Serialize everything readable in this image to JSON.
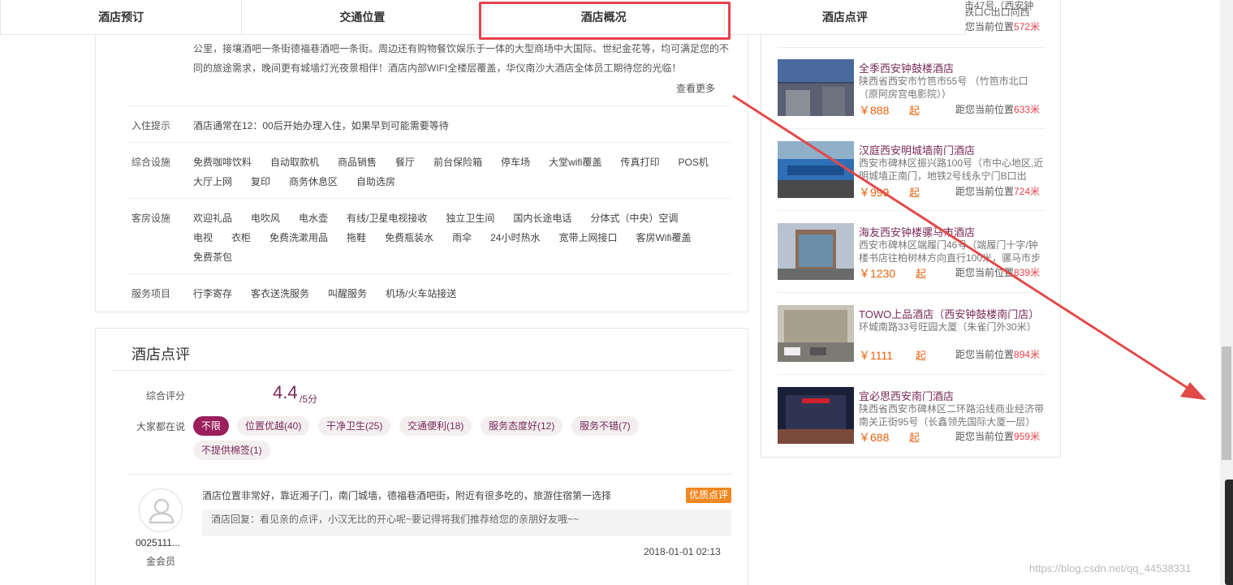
{
  "tabs": [
    "酒店预订",
    "交通位置",
    "酒店概况",
    "酒店点评"
  ],
  "overview": {
    "intro_lines": [
      "公里，接壤酒吧一条街德福巷酒吧一条街。周边还有购物餐饮娱乐于一体的大型商场中大国际、世纪金花等，均可满足您的不",
      "同的旅途需求，晚间更有城墙灯光夜景相伴！酒店内部WIFI全楼层覆盖，华仪南沙大酒店全体员工期待您的光临！"
    ],
    "more": "查看更多",
    "checkin_label": "入住提示",
    "checkin_text": "酒店通常在12：00后开始办理入住，如果早到可能需要等待",
    "general_label": "综合设施",
    "general_row1": [
      "免费咖啡饮料",
      "自动取款机",
      "商品销售",
      "餐厅",
      "前台保险箱",
      "停车场",
      "大堂wifi覆盖",
      "传真打印",
      "POS机"
    ],
    "general_row2": [
      "大厅上网",
      "复印",
      "商务休息区",
      "自助选房"
    ],
    "room_label": "客房设施",
    "room_row1": [
      "欢迎礼品",
      "电吹风",
      "电水壶",
      "有线/卫星电视接收",
      "独立卫生间",
      "国内长途电话",
      "分体式（中央）空调"
    ],
    "room_row2": [
      "电视",
      "衣柜",
      "免费洗漱用品",
      "拖鞋",
      "免费瓶装水",
      "雨伞",
      "24小时热水",
      "宽带上网接口",
      "客房Wifi覆盖"
    ],
    "room_row3": [
      "免费茶包"
    ],
    "service_label": "服务项目",
    "service_row": [
      "行李寄存",
      "客衣送洗服务",
      "叫醒服务",
      "机场/火车站接送"
    ]
  },
  "reviews": {
    "title": "酒店点评",
    "score_label": "综合评分",
    "score": "4.4",
    "score_unit": "/5分",
    "tags_label": "大家都在说",
    "tags": [
      "不限",
      "位置优越(40)",
      "干净卫生(25)",
      "交通便利(18)",
      "服务态度好(12)",
      "服务不错(7)",
      "不提供棉签(1)"
    ],
    "item": {
      "user": "0025111...",
      "level": "金会员",
      "text": "酒店位置非常好，靠近湘子门，南门城墙，德福巷酒吧街，附近有很多吃的，旅游住宿第一选择",
      "badge": "优质点评",
      "reply": "酒店回复：看见亲的点评，小汉无比的开心呢~要记得将我们推荐给您的亲朋好友哦~~",
      "date": "2018-01-01 02:13"
    }
  },
  "nearby": {
    "top_frag1": "市47号（西安钟",
    "top_frag2": "铁口C出口向西",
    "top_dist_prefix": "距您当前位置",
    "top_dist": "572米",
    "dist_prefix": "距您当前位置",
    "qi": "起",
    "hotels": [
      {
        "name": "全季西安钟鼓楼酒店",
        "addr": "陕西省西安市竹笆市55号 （竹笆市北口（原阿房宫电影院））",
        "price": "￥888",
        "dist": "633米"
      },
      {
        "name": "汉庭西安明城墙南门酒店",
        "addr": "西安市碑林区振兴路100号（市中心地区,近明城墙正南门，地铁2号线永宁门B口出",
        "price": "￥999",
        "dist": "724米"
      },
      {
        "name": "海友西安钟楼骡马市酒店",
        "addr": "西安市碑林区端履门46号（端履门十字/钟楼书店往柏树林方向直行100米，骡马市步",
        "price": "￥1230",
        "dist": "839米"
      },
      {
        "name": "TOWO上品酒店（西安钟鼓楼南门店）",
        "addr": "环城南路33号旺园大厦（朱雀门外30米）",
        "price": "￥1111",
        "dist": "894米"
      },
      {
        "name": "宜必思西安南门酒店",
        "addr": "陕西省西安市碑林区二环路沿线商业经济带南关正街95号（长鑫领先国际大厦一层）",
        "price": "￥688",
        "dist": "959米"
      }
    ]
  },
  "watermark": "https://blog.csdn.net/qq_44538331",
  "colors": {
    "accent": "#9a1f5c",
    "price": "#e8600c",
    "highlight": "#e8414a"
  }
}
